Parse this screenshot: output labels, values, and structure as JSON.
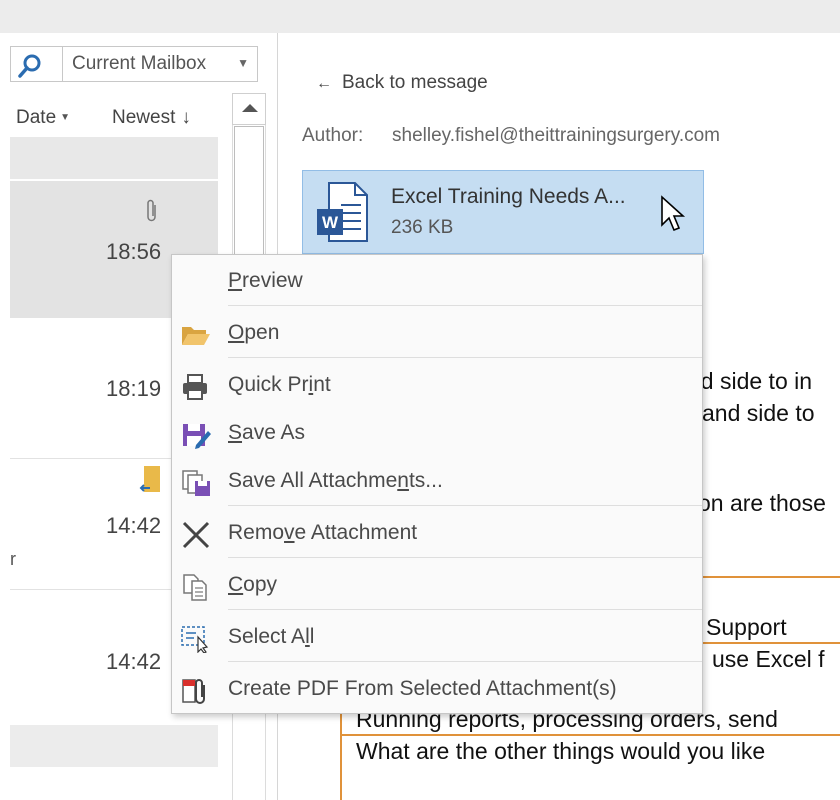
{
  "search": {
    "scope": "Current Mailbox"
  },
  "list": {
    "sort_by": "Date",
    "sort_order": "Newest",
    "sort_arrow": "↓",
    "times": [
      "18:56",
      "18:19",
      "14:42",
      "14:42"
    ],
    "partial_char": "r"
  },
  "reading": {
    "back_label": "Back to message",
    "author_label": "Author:",
    "author_value": "shelley.fishel@theittrainingsurgery.com",
    "attachment": {
      "name": "Excel Training Needs A...",
      "size": "236 KB",
      "icon": "word-doc-icon"
    },
    "body_lines": [
      "nd side to in",
      "and side to",
      "on are those",
      "r Support",
      "use Excel f",
      "Running reports, processing orders, send",
      "What are the other things would you like"
    ]
  },
  "context_menu": {
    "items": [
      {
        "pre": "",
        "u": "P",
        "post": "review",
        "icon": "none"
      },
      {
        "pre": "",
        "u": "O",
        "post": "pen",
        "icon": "folder-open-icon"
      },
      {
        "pre": "Quick Pr",
        "u": "i",
        "post": "nt",
        "icon": "printer-icon"
      },
      {
        "pre": "",
        "u": "S",
        "post": "ave As",
        "icon": "save-as-icon"
      },
      {
        "pre": "Save All Attachme",
        "u": "n",
        "post": "ts...",
        "icon": "save-all-icon"
      },
      {
        "pre": "Remo",
        "u": "v",
        "post": "e Attachment",
        "icon": "remove-x-icon"
      },
      {
        "pre": "",
        "u": "C",
        "post": "opy",
        "icon": "copy-icon"
      },
      {
        "pre": "Select A",
        "u": "l",
        "post": "l",
        "icon": "select-all-icon"
      },
      {
        "pre": "Create PDF From Selected Attachment(s)",
        "u": "",
        "post": "",
        "icon": "pdf-attach-icon"
      }
    ]
  },
  "colors": {
    "accent_orange": "#e0923a",
    "selection_blue": "#c5ddf2",
    "word_blue": "#2b5797"
  }
}
